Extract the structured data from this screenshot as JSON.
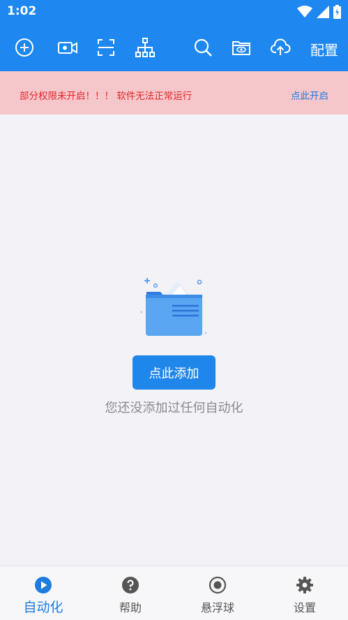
{
  "status_bar": {
    "time": "1:02"
  },
  "toolbar": {
    "icons": [
      "add-circle-icon",
      "video-record-icon",
      "scan-frame-icon",
      "hierarchy-icon",
      "search-icon",
      "folder-eye-icon",
      "cloud-upload-icon"
    ],
    "config_label": "配置"
  },
  "warning": {
    "message": "部分权限未开启！！！ 软件无法正常运行",
    "action": "点此开启"
  },
  "empty_state": {
    "button_label": "点此添加",
    "message": "您还没添加过任何自动化"
  },
  "bottom_nav": {
    "items": [
      {
        "label": "自动化",
        "icon": "play-circle-icon",
        "active": true
      },
      {
        "label": "帮助",
        "icon": "help-circle-icon",
        "active": false
      },
      {
        "label": "悬浮球",
        "icon": "record-circle-icon",
        "active": false
      },
      {
        "label": "设置",
        "icon": "gear-icon",
        "active": false
      }
    ]
  },
  "colors": {
    "primary": "#1e88f0",
    "warning_bg": "#f6c7ca",
    "warning_text": "#e0262b",
    "link": "#1e7be0",
    "background": "#f2f2f7"
  }
}
